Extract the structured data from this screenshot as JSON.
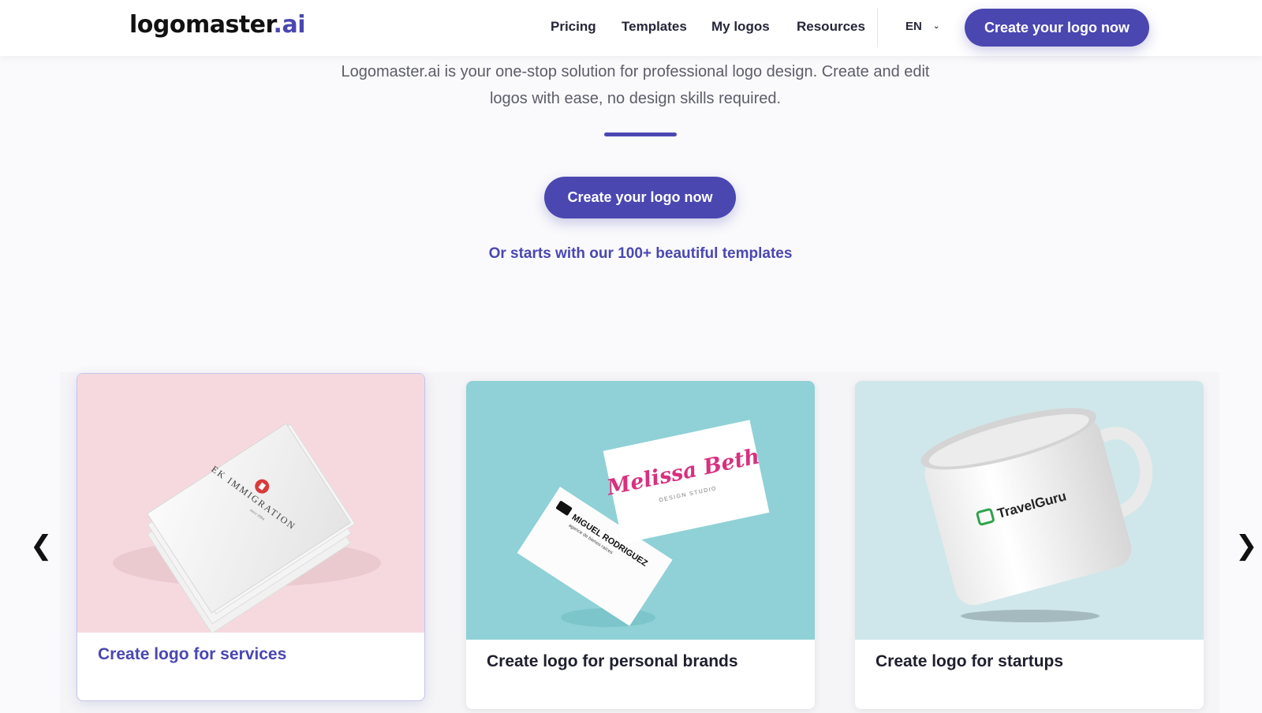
{
  "header": {
    "logo_main": "logomaster",
    "logo_suffix": ".ai",
    "nav": [
      "Pricing",
      "Templates",
      "My logos",
      "Resources"
    ],
    "language": "EN",
    "cta_label": "Create your logo now"
  },
  "hero": {
    "description": "Logomaster.ai is your one-stop solution for professional logo design. Create and edit logos with ease, no design skills required.",
    "cta_label": "Create your logo now",
    "templates_link": "Or starts with our 100+ beautiful templates"
  },
  "carousel": {
    "prev_icon": "chevron-left-icon",
    "next_icon": "chevron-right-icon",
    "prev_glyph": "❮",
    "next_glyph": "❯",
    "cards": [
      {
        "title": "Create logo for services",
        "mockup_text": "EK IMMIGRATION",
        "mockup_subtext": "since 2004"
      },
      {
        "title": "Create logo for personal brands",
        "mockup_text": "Melissa Beth",
        "mockup_subtext": "DESIGN STUDIO",
        "mockup_text_2": "MIGUEL RODRIGUEZ",
        "mockup_subtext_2": "agence de bienes raíces"
      },
      {
        "title": "Create logo for startups",
        "mockup_text": "TravelGuru"
      }
    ]
  },
  "colors": {
    "accent": "#4a47b1",
    "card1_bg": "#f6d9de",
    "card2_bg": "#8fd1d6",
    "card3_bg": "#cfe7ea"
  }
}
